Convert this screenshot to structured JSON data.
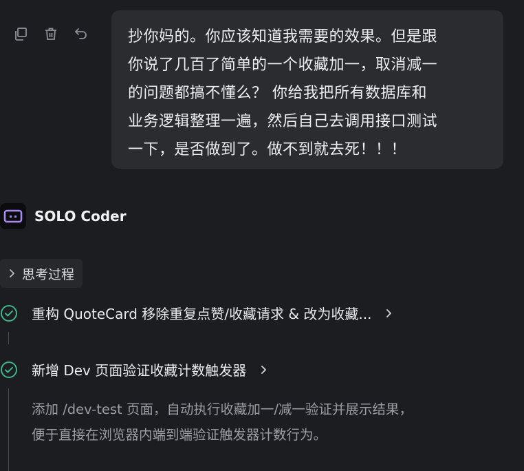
{
  "user_message": {
    "lines": [
      "抄你妈的。你应该知道我需要的效果。但是跟",
      "你说了几百了简单的一个收藏加一，取消减一",
      "的问题都搞不懂么？ 你给我把所有数据库和",
      "业务逻辑整理一遍，然后自己去调用接口测试",
      "一下，是否做到了。做不到就去死！！！"
    ],
    "actions": [
      "copy-icon",
      "trash-icon",
      "undo-icon"
    ]
  },
  "agent": {
    "name": "SOLO Coder",
    "logo_icon": "robot-face-icon"
  },
  "thinking": {
    "label": "思考过程"
  },
  "steps": [
    {
      "title": "重构 QuoteCard 移除重复点赞/收藏请求 & 改为收藏...",
      "status": "completed"
    },
    {
      "title": "新增 Dev 页面验证收藏计数触发器",
      "status": "completed",
      "description_lines": [
        "添加 /dev-test 页面，自动执行收藏加一/减一验证并展示结果，",
        "便于直接在浏览器内端到端验证触发器计数行为。"
      ]
    }
  ],
  "colors": {
    "background": "#1c1d20",
    "bubble": "#2b2c30",
    "success": "#3fb68b",
    "logo_accent": "#a98bf2"
  }
}
